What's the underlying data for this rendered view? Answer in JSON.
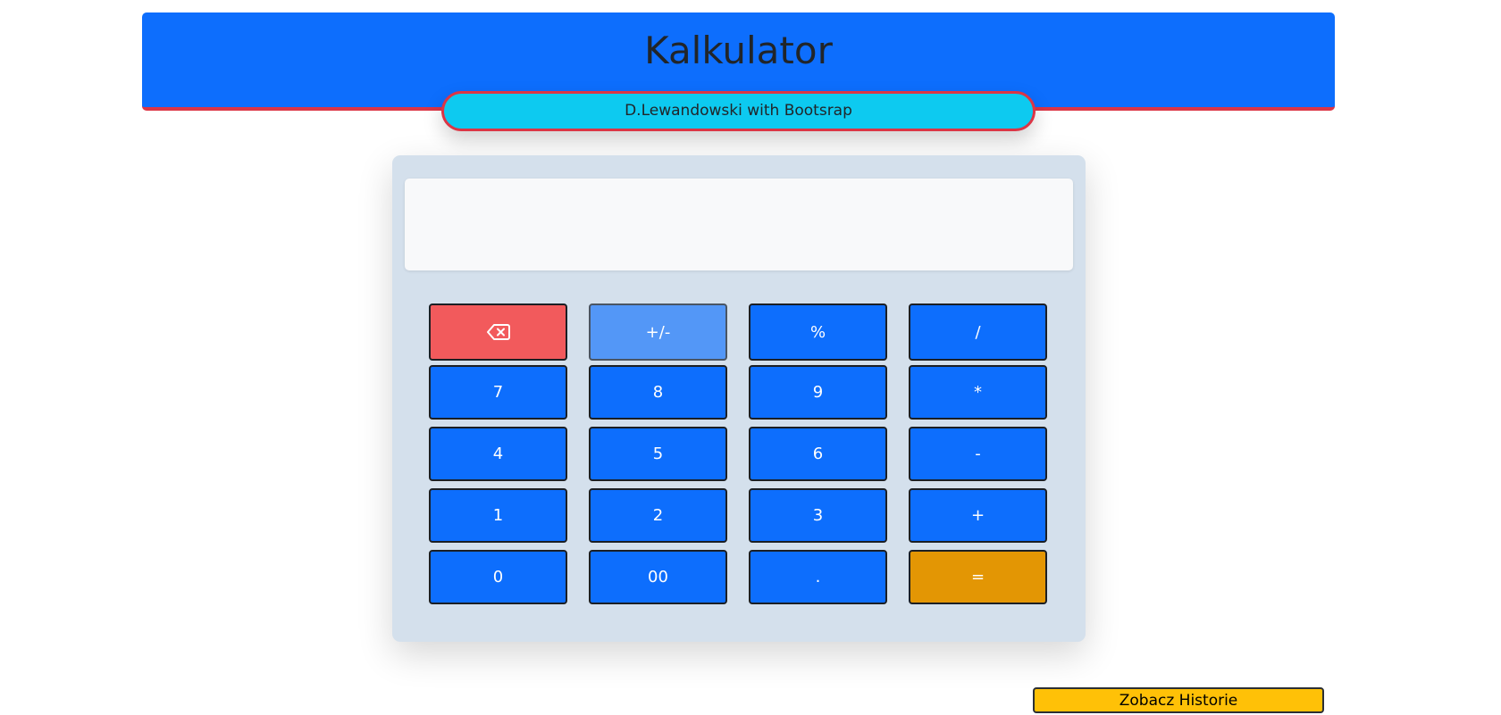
{
  "header": {
    "title": "Kalkulator",
    "subtitle": "D.Lewandowski with Bootsrap"
  },
  "display": {
    "value": ""
  },
  "keys": [
    {
      "label": "",
      "icon": "backspace-icon",
      "name": "backspace-button"
    },
    {
      "label": "+/-",
      "name": "toggle-sign-button"
    },
    {
      "label": "%",
      "name": "percent-button"
    },
    {
      "label": "/",
      "name": "divide-button"
    },
    {
      "label": "7",
      "name": "digit-7-button"
    },
    {
      "label": "8",
      "name": "digit-8-button"
    },
    {
      "label": "9",
      "name": "digit-9-button"
    },
    {
      "label": "*",
      "name": "multiply-button"
    },
    {
      "label": "4",
      "name": "digit-4-button"
    },
    {
      "label": "5",
      "name": "digit-5-button"
    },
    {
      "label": "6",
      "name": "digit-6-button"
    },
    {
      "label": "-",
      "name": "subtract-button"
    },
    {
      "label": "1",
      "name": "digit-1-button"
    },
    {
      "label": "2",
      "name": "digit-2-button"
    },
    {
      "label": "3",
      "name": "digit-3-button"
    },
    {
      "label": "+",
      "name": "add-button"
    },
    {
      "label": "0",
      "name": "digit-0-button"
    },
    {
      "label": "00",
      "name": "double-zero-button"
    },
    {
      "label": ".",
      "name": "decimal-button"
    },
    {
      "label": "=",
      "name": "equals-button"
    }
  ],
  "history_button": {
    "label": "Zobacz Historie"
  },
  "colors": {
    "header": "#0d6efd",
    "header_border": "#dc3545",
    "subtitle_bg": "#0dcaf0",
    "calculator_bg": "#d4e0ec",
    "key_primary": "#0d6efd",
    "key_backspace": "#f25a5c",
    "key_toggle": "#5397f7",
    "key_equals": "#e39604",
    "history_button": "#ffc107"
  }
}
